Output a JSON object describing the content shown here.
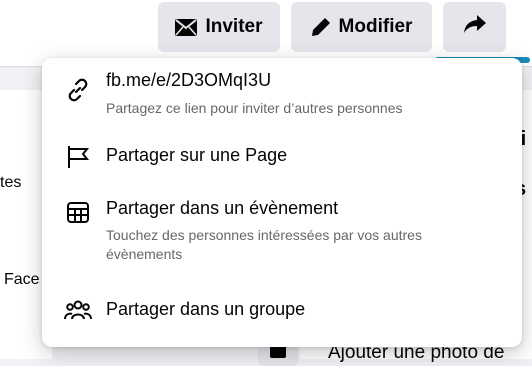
{
  "toolbar": {
    "invite_label": "Inviter",
    "edit_label": "Modifier"
  },
  "share_menu": {
    "items": [
      {
        "title": "fb.me/e/2D3OMqI3U",
        "subtitle": "Partagez ce lien pour inviter d’autres personnes",
        "icon": "link-icon"
      },
      {
        "title": "Partager sur une Page",
        "icon": "flag-icon"
      },
      {
        "title": "Partager dans un évènement",
        "subtitle": "Touchez des personnes intéressées par vos autres évènements",
        "icon": "calendar-icon"
      },
      {
        "title": "Partager dans un groupe",
        "icon": "group-icon"
      }
    ]
  },
  "background": {
    "left_text_1": "tes",
    "left_text_2": "Face",
    "right_text_1": "ti",
    "right_text_2": "s",
    "right_text_3": "tt",
    "bottom_text": "Ajouter une photo de"
  },
  "colors": {
    "accent_underline": "#1b8bb8",
    "button_bg": "#e4e6eb",
    "secondary_text": "#65676b"
  }
}
